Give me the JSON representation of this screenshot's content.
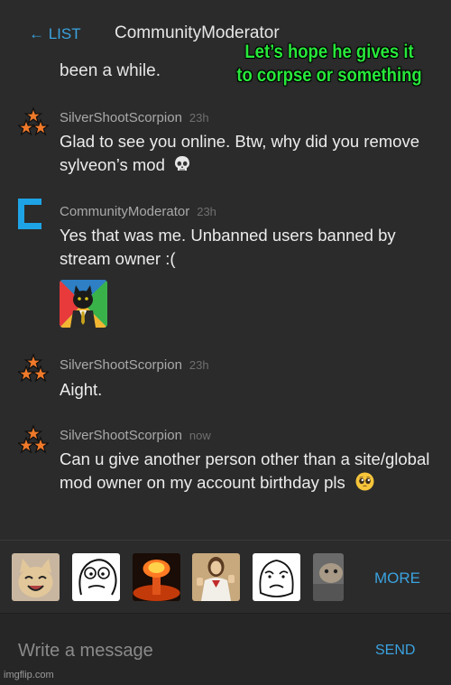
{
  "header": {
    "back_label": "← LIST",
    "title": "CommunityModerator"
  },
  "cut_off_text": "been a while.",
  "caption_text": "Let’s hope he gives it to corpse or something",
  "messages": [
    {
      "user": "SilverShootScorpion",
      "time": "23h",
      "text": "Glad to see you online. Btw, why did you remove sylveon’s mod",
      "emoji": "skull-emoji",
      "avatar": "three-stars-icon"
    },
    {
      "user": "CommunityModerator",
      "time": "23h",
      "text": "Yes that was me. Unbanned users banned by stream owner :(",
      "avatar": "moderator-bracket-icon",
      "image": "business-cat-image"
    },
    {
      "user": "SilverShootScorpion",
      "time": "23h",
      "text": "Aight.",
      "avatar": "three-stars-icon"
    },
    {
      "user": "SilverShootScorpion",
      "time": "now",
      "text": "Can u give another person other than a site/global mod owner on my account birthday pls",
      "emoji": "pleading-face-emoji",
      "avatar": "three-stars-icon"
    }
  ],
  "stickers": [
    "happy-cat-sticker",
    "rage-face-sticker",
    "explosion-sticker",
    "buddy-christ-sticker",
    "okay-face-sticker",
    "cat-sticker"
  ],
  "strip": {
    "more_label": "MORE"
  },
  "composer": {
    "placeholder": "Write a message",
    "send_label": "SEND"
  },
  "watermark": "imgflip.com",
  "colors": {
    "accent": "#3ba3e0",
    "caption": "#27e83a",
    "background": "#2b2b2b"
  }
}
